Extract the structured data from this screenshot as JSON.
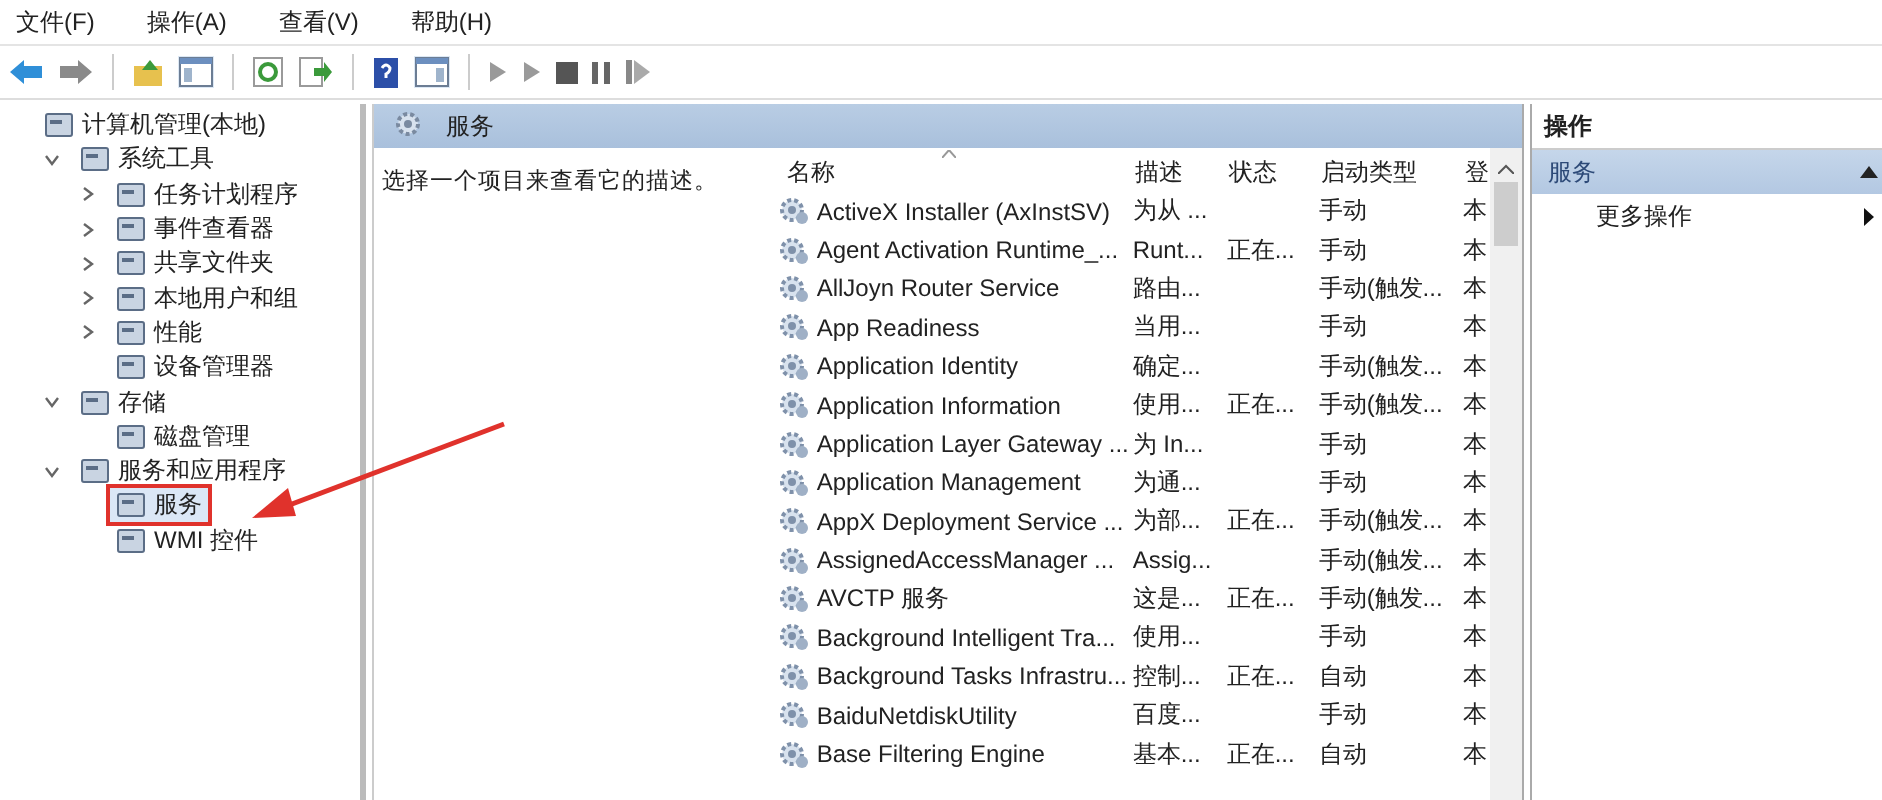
{
  "menu": [
    "文件(F)",
    "操作(A)",
    "查看(V)",
    "帮助(H)"
  ],
  "tree": [
    {
      "label": "计算机管理(本地)",
      "children": [
        {
          "label": "系统工具",
          "expanded": true,
          "children": [
            {
              "label": "任务计划程序",
              "expanded": false
            },
            {
              "label": "事件查看器",
              "expanded": false
            },
            {
              "label": "共享文件夹",
              "expanded": false
            },
            {
              "label": "本地用户和组",
              "expanded": false
            },
            {
              "label": "性能",
              "expanded": false
            },
            {
              "label": "设备管理器"
            }
          ]
        },
        {
          "label": "存储",
          "expanded": true,
          "children": [
            {
              "label": "磁盘管理"
            }
          ]
        },
        {
          "label": "服务和应用程序",
          "expanded": true,
          "children": [
            {
              "label": "服务",
              "selected": true
            },
            {
              "label": "WMI 控件",
              "selected": false
            }
          ]
        }
      ]
    }
  ],
  "center": {
    "title": "服务",
    "description": "选择一个项目来查看它的描述。"
  },
  "table": {
    "columns": [
      "名称",
      "描述",
      "状态",
      "启动类型",
      "登"
    ],
    "rows": [
      [
        "ActiveX Installer (AxInstSV)",
        "为从 ...",
        "",
        "手动",
        "本"
      ],
      [
        "Agent Activation Runtime_...",
        "Runt...",
        "正在...",
        "手动",
        "本"
      ],
      [
        "AllJoyn Router Service",
        "路由...",
        "",
        "手动(触发...",
        "本"
      ],
      [
        "App Readiness",
        "当用...",
        "",
        "手动",
        "本"
      ],
      [
        "Application Identity",
        "确定...",
        "",
        "手动(触发...",
        "本"
      ],
      [
        "Application Information",
        "使用...",
        "正在...",
        "手动(触发...",
        "本"
      ],
      [
        "Application Layer Gateway ...",
        "为 In...",
        "",
        "手动",
        "本"
      ],
      [
        "Application Management",
        "为通...",
        "",
        "手动",
        "本"
      ],
      [
        "AppX Deployment Service ...",
        "为部...",
        "正在...",
        "手动(触发...",
        "本"
      ],
      [
        "AssignedAccessManager ...",
        "Assig...",
        "",
        "手动(触发...",
        "本"
      ],
      [
        "AVCTP 服务",
        "这是...",
        "正在...",
        "手动(触发...",
        "本"
      ],
      [
        "Background Intelligent Tra...",
        "使用...",
        "",
        "手动",
        "本"
      ],
      [
        "Background Tasks Infrastru...",
        "控制...",
        "正在...",
        "自动",
        "本"
      ],
      [
        "BaiduNetdiskUtility",
        "百度...",
        "",
        "手动",
        "本"
      ],
      [
        "Base Filtering Engine",
        "基本...",
        "正在...",
        "自动",
        "本"
      ]
    ]
  },
  "actions": {
    "title": "操作",
    "section": "服务",
    "items": [
      "更多操作"
    ]
  }
}
